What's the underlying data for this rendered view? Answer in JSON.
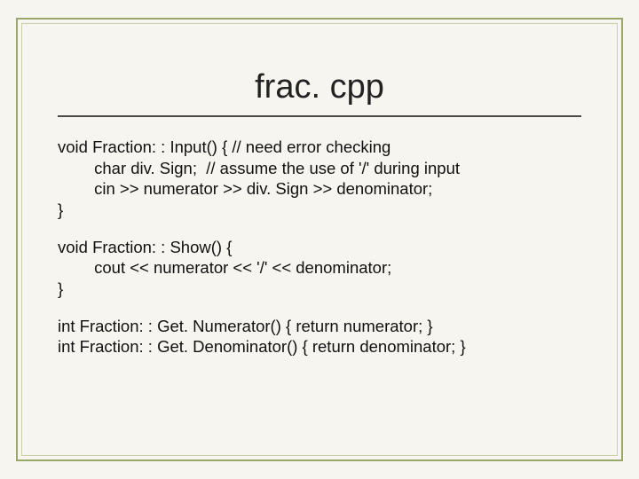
{
  "title": "frac. cpp",
  "code": {
    "block1": {
      "l1": "void Fraction: : Input() { // need error checking",
      "l2": "        char div. Sign;  // assume the use of '/' during input",
      "l3": "        cin >> numerator >> div. Sign >> denominator;",
      "l4": "}"
    },
    "block2": {
      "l1": "void Fraction: : Show() {",
      "l2": "        cout << numerator << '/' << denominator;",
      "l3": "}"
    },
    "block3": {
      "l1": "int Fraction: : Get. Numerator() { return numerator; }",
      "l2": "int Fraction: : Get. Denominator() { return denominator; }"
    }
  }
}
